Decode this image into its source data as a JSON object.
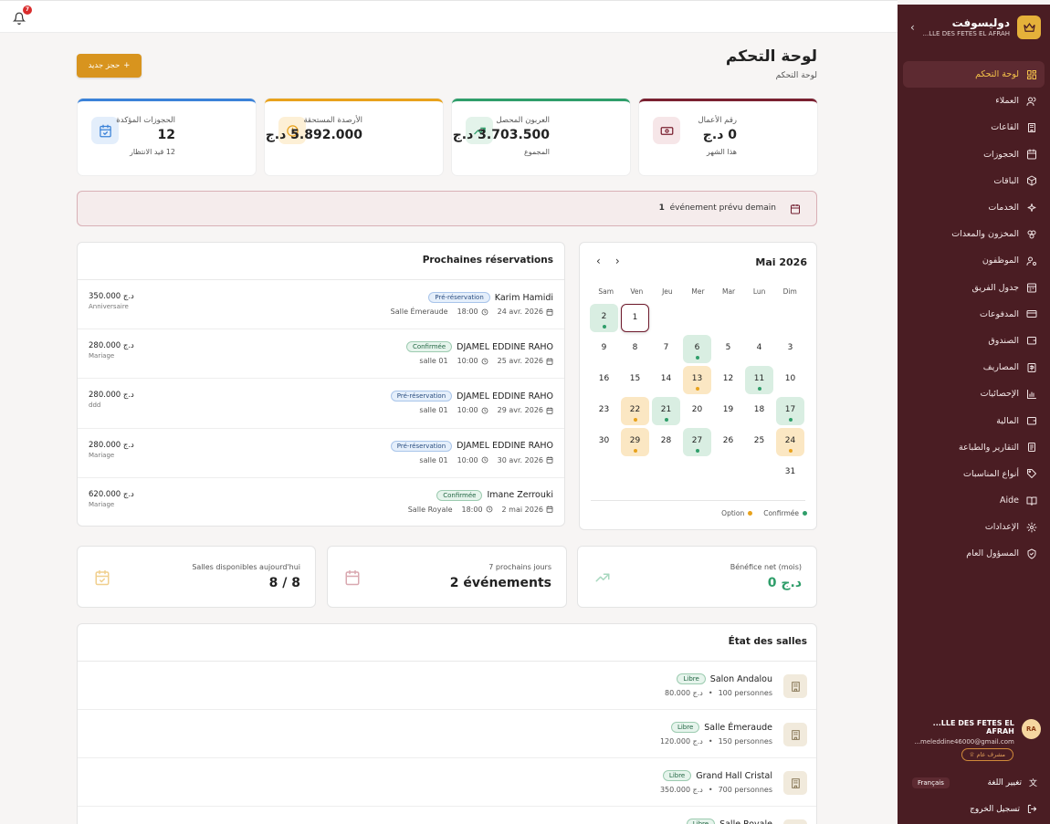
{
  "topbar": {
    "notif_count": "7"
  },
  "sidebar": {
    "brand_name": "دوليسوفت",
    "brand_sub": "...LLE DES FETES EL AFRAH",
    "items": [
      {
        "label": "لوحة التحكم",
        "icon": "dashboard-icon"
      },
      {
        "label": "العملاء",
        "icon": "users-icon"
      },
      {
        "label": "القاعات",
        "icon": "building-icon"
      },
      {
        "label": "الحجوزات",
        "icon": "calendar-icon"
      },
      {
        "label": "الباقات",
        "icon": "package-icon"
      },
      {
        "label": "الخدمات",
        "icon": "sparkles-icon"
      },
      {
        "label": "المخزون والمعدات",
        "icon": "boxes-icon"
      },
      {
        "label": "الموظفون",
        "icon": "user-gear-icon"
      },
      {
        "label": "جدول الفريق",
        "icon": "schedule-icon"
      },
      {
        "label": "المدفوعات",
        "icon": "card-icon"
      },
      {
        "label": "الصندوق",
        "icon": "wallet-icon"
      },
      {
        "label": "المصاريف",
        "icon": "receipt-icon"
      },
      {
        "label": "الإحصائيات",
        "icon": "bar-chart-icon"
      },
      {
        "label": "المالية",
        "icon": "wallet-icon"
      },
      {
        "label": "التقارير والطباعة",
        "icon": "report-icon"
      },
      {
        "label": "أنواع المناسبات",
        "icon": "tag-icon"
      },
      {
        "label": "Aide",
        "icon": "book-icon"
      },
      {
        "label": "الإعدادات",
        "icon": "gear-icon"
      },
      {
        "label": "المسؤول العام",
        "icon": "shield-icon"
      }
    ],
    "user_initials": "RA",
    "user_name": "...LLE DES FETES EL AFRAH",
    "user_email": "...meleddine46000@gmail.com",
    "role": "مشرف عام",
    "lang_label": "تغيير اللغة",
    "lang_value": "Français",
    "logout": "تسجيل الخروج"
  },
  "header": {
    "title": "لوحة التحكم",
    "breadcrumb": "لوحة التحكم",
    "new_button": "حجز جديد"
  },
  "stats": [
    {
      "label": "رقم الأعمال",
      "value": "0 د.ج",
      "sub": "هذا الشهر",
      "color": "#7a2030",
      "icon": "money-icon"
    },
    {
      "label": "العربون المحصل",
      "value": "3.703.500 د.ج",
      "sub": "المجموع",
      "color": "#2f9e6a",
      "icon": "trend-up-icon"
    },
    {
      "label": "الأرصدة المستحقة",
      "value": "5.892.000 د.ج",
      "sub": "",
      "color": "#e8a21c",
      "icon": "clock-icon"
    },
    {
      "label": "الحجوزات المؤكدة",
      "value": "12",
      "sub": "12 قيد الانتظار",
      "color": "#3b82d8",
      "icon": "calendar-check-icon"
    }
  ],
  "alert": {
    "text": "événement prévu demain",
    "count": "1"
  },
  "reservations": {
    "title": "Prochaines réservations",
    "rows": [
      {
        "name": "Karim Hamidi",
        "status": "Pré-réservation",
        "kind": "pre",
        "date": "24 avr. 2026",
        "time": "18:00",
        "hall": "Salle Émeraude",
        "amount": "350.000 د.ج",
        "type": "Anniversaire"
      },
      {
        "name": "DJAMEL EDDINE RAHO",
        "status": "Confirmée",
        "kind": "conf",
        "date": "25 avr. 2026",
        "time": "10:00",
        "hall": "salle 01",
        "amount": "280.000 د.ج",
        "type": "Mariage"
      },
      {
        "name": "DJAMEL EDDINE RAHO",
        "status": "Pré-réservation",
        "kind": "pre",
        "date": "29 avr. 2026",
        "time": "10:00",
        "hall": "salle 01",
        "amount": "280.000 د.ج",
        "type": "ddd"
      },
      {
        "name": "DJAMEL EDDINE RAHO",
        "status": "Pré-réservation",
        "kind": "pre",
        "date": "30 avr. 2026",
        "time": "10:00",
        "hall": "salle 01",
        "amount": "280.000 د.ج",
        "type": "Mariage"
      },
      {
        "name": "Imane Zerrouki",
        "status": "Confirmée",
        "kind": "conf",
        "date": "2 mai 2026",
        "time": "18:00",
        "hall": "Salle Royale",
        "amount": "620.000 د.ج",
        "type": "Mariage"
      }
    ]
  },
  "calendar": {
    "title": "Mai 2026",
    "weekdays": [
      "Dim",
      "Lun",
      "Mar",
      "Mer",
      "Jeu",
      "Ven",
      "Sam"
    ],
    "first_weekday": 5,
    "days_in_month": 31,
    "today": 1,
    "confirmed": [
      2,
      6,
      11,
      17,
      21,
      27
    ],
    "option": [
      13,
      22,
      24,
      29
    ],
    "legend_confirmed": "Confirmée",
    "legend_option": "Option",
    "confirmed_color": "#2f9e6a",
    "option_color": "#e8a21c"
  },
  "mini_stats": [
    {
      "label": "Bénéfice net (mois)",
      "value": "0 د.ج",
      "icon": "trend-up-icon",
      "value_color": "#2f9e6a"
    },
    {
      "label": "7 prochains jours",
      "value": "2 événements",
      "icon": "calendar-icon",
      "value_color": "#222"
    },
    {
      "label": "Salles disponibles aujourd'hui",
      "value": "8 / 8",
      "icon": "calendar-check-icon",
      "value_color": "#222"
    }
  ],
  "salles": {
    "title": "État des salles",
    "rows": [
      {
        "name": "Salon Andalou",
        "status": "Libre",
        "capacity": "100 personnes",
        "price": "80.000 د.ج"
      },
      {
        "name": "Salle Émeraude",
        "status": "Libre",
        "capacity": "150 personnes",
        "price": "120.000 د.ج"
      },
      {
        "name": "Grand Hall Cristal",
        "status": "Libre",
        "capacity": "700 personnes",
        "price": "350.000 د.ج"
      },
      {
        "name": "Salle Royale",
        "status": "Libre",
        "capacity": "",
        "price": ""
      }
    ]
  }
}
